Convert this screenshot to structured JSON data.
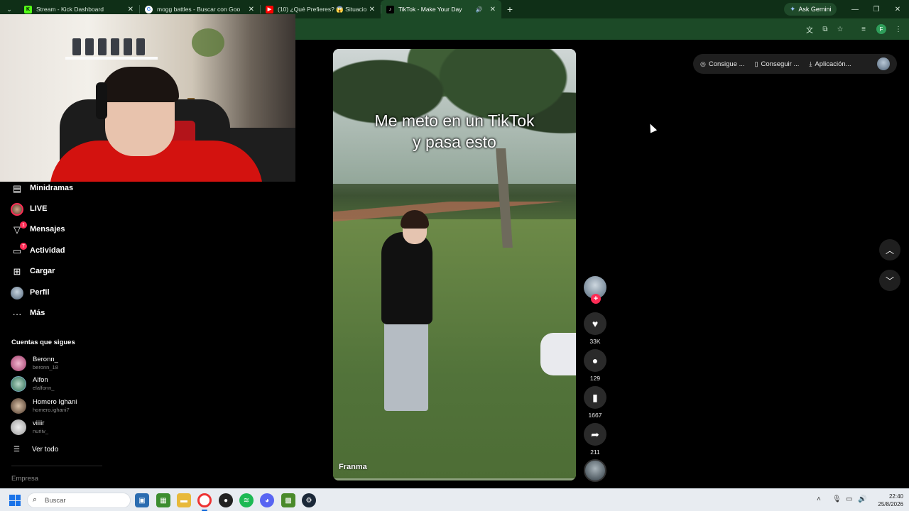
{
  "browser": {
    "tabs": [
      {
        "label": "Stream - Kick Dashboard",
        "favicon": "kick-icon",
        "color": "#53fc18"
      },
      {
        "label": "mogg battles - Buscar con Goo",
        "favicon": "google-icon",
        "color": "#ffffff"
      },
      {
        "label": "(10) ¿Qué Prefieres? 😱 Situacio",
        "favicon": "youtube-icon",
        "color": "#ff0000"
      },
      {
        "label": "TikTok - Make Your Day",
        "favicon": "tiktok-icon",
        "color": "#000000",
        "active": true
      }
    ],
    "gemini_label": "Ask Gemini",
    "profile_initial": "F"
  },
  "sidebar": {
    "items": [
      {
        "label": "Minidramas",
        "icon": "minidramas-icon"
      },
      {
        "label": "LIVE",
        "icon": "live-avatar"
      },
      {
        "label": "Mensajes",
        "icon": "messages-icon",
        "badge": "1"
      },
      {
        "label": "Actividad",
        "icon": "activity-icon",
        "badge": "7"
      },
      {
        "label": "Cargar",
        "icon": "upload-icon"
      },
      {
        "label": "Perfil",
        "icon": "profile-avatar"
      },
      {
        "label": "Más",
        "icon": "more-icon"
      }
    ],
    "following_title": "Cuentas que sigues",
    "following": [
      {
        "name": "Beronn_",
        "handle": "beronn_18"
      },
      {
        "name": "Alfon",
        "handle": "elalfonn_"
      },
      {
        "name": "Homero Ighani",
        "handle": "homero.ighani7"
      },
      {
        "name": "viiiir",
        "handle": "nuriiv_"
      }
    ],
    "see_all": "Ver todo",
    "company": "Empresa"
  },
  "topbar": {
    "pills": [
      {
        "label": "Consigue ...",
        "icon": "coin-icon"
      },
      {
        "label": "Conseguir ...",
        "icon": "phone-icon"
      },
      {
        "label": "Aplicación...",
        "icon": "download-icon"
      }
    ]
  },
  "video": {
    "caption_line1": "Me meto en un TikTok",
    "caption_line2": "y pasa esto",
    "author": "Franma"
  },
  "actions": {
    "likes": "33K",
    "comments": "129",
    "saves": "1667",
    "shares": "211"
  },
  "taskbar": {
    "search_placeholder": "Buscar",
    "time": "22:40",
    "date": "25/8/2026"
  },
  "colors": {
    "chrome_frame": "#0f2f17",
    "chrome_toolbar": "#1c4a27",
    "tiktok_pink": "#fe2c55"
  }
}
